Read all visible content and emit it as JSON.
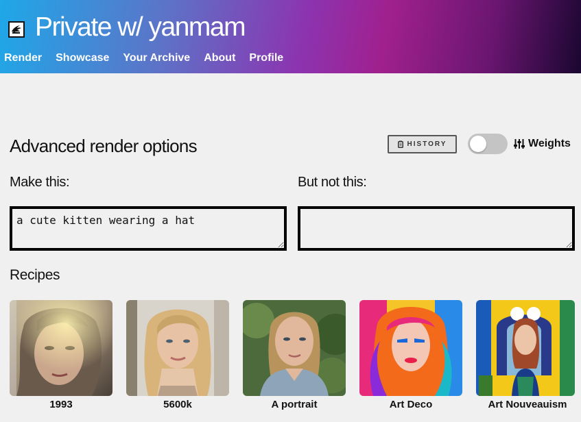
{
  "header": {
    "title": "Private w/ yanmam",
    "nav": [
      "Render",
      "Showcase",
      "Your Archive",
      "About",
      "Profile"
    ]
  },
  "advanced": {
    "title": "Advanced render options",
    "history_label": "HISTORY",
    "weights_label": "Weights",
    "weights_enabled": false
  },
  "prompt": {
    "make_label": "Make this:",
    "make_value": "a cute kitten wearing a hat",
    "not_label": "But not this:",
    "not_value": ""
  },
  "recipes": {
    "title": "Recipes",
    "items": [
      "1993",
      "5600k",
      "A portrait",
      "Art Deco",
      "Art Nouveauism"
    ]
  },
  "colors": {
    "header_gradient": [
      "#1ea8e8",
      "#8c34b0",
      "#a0208e",
      "#1a0630"
    ],
    "text": "#111111",
    "background": "#f0f0f0"
  }
}
